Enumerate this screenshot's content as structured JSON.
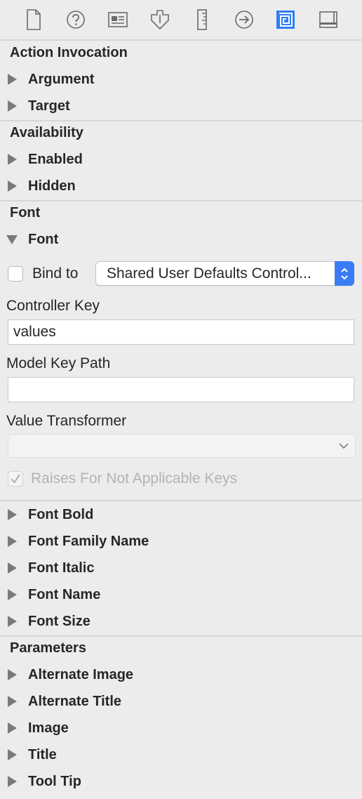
{
  "toolbar": {
    "icons": [
      {
        "name": "file-inspector-icon"
      },
      {
        "name": "quick-help-icon"
      },
      {
        "name": "identity-inspector-icon"
      },
      {
        "name": "attributes-inspector-icon"
      },
      {
        "name": "size-inspector-icon"
      },
      {
        "name": "connections-inspector-icon"
      },
      {
        "name": "bindings-inspector-icon",
        "active": true
      },
      {
        "name": "view-effects-inspector-icon"
      }
    ],
    "accent_color": "#2f7cf6"
  },
  "sections": {
    "action_invocation": "Action Invocation",
    "availability": "Availability",
    "font": "Font",
    "parameters": "Parameters"
  },
  "items": {
    "argument": "Argument",
    "target": "Target",
    "enabled": "Enabled",
    "hidden": "Hidden",
    "font": "Font",
    "font_bold": "Font Bold",
    "font_family_name": "Font Family Name",
    "font_italic": "Font Italic",
    "font_name": "Font Name",
    "font_size": "Font Size",
    "alternate_image": "Alternate Image",
    "alternate_title": "Alternate Title",
    "image": "Image",
    "title": "Title",
    "tool_tip": "Tool Tip"
  },
  "font_binding": {
    "bind_to_label": "Bind to",
    "bind_to_checked": false,
    "bind_to_value": "Shared User Defaults Control...",
    "controller_key_label": "Controller Key",
    "controller_key_value": "values",
    "model_key_path_label": "Model Key Path",
    "model_key_path_value": "",
    "value_transformer_label": "Value Transformer",
    "value_transformer_value": "",
    "raises_label": "Raises For Not Applicable Keys",
    "raises_checked": true
  }
}
